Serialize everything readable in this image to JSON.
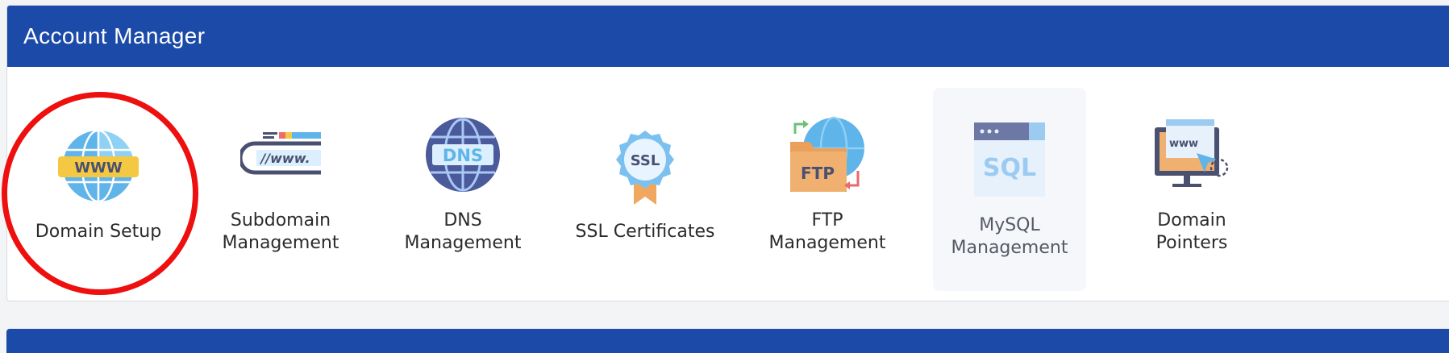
{
  "panel": {
    "title": "Account Manager",
    "items": [
      {
        "label": "Domain Setup",
        "icon": "www-globe-icon"
      },
      {
        "label": "Subdomain\nManagement",
        "icon": "subdomain-bar-icon"
      },
      {
        "label": "DNS\nManagement",
        "icon": "dns-globe-icon"
      },
      {
        "label": "SSL Certificates",
        "icon": "ssl-badge-icon"
      },
      {
        "label": "FTP\nManagement",
        "icon": "ftp-folder-icon"
      },
      {
        "label": "MySQL\nManagement",
        "icon": "sql-window-icon"
      },
      {
        "label": "Domain\nPointers",
        "icon": "pointer-monitor-icon"
      }
    ]
  },
  "icon_text": {
    "www": "WWW",
    "subdomain": "//www.",
    "dns": "DNS",
    "ssl": "SSL",
    "ftp": "FTP",
    "sql": "SQL",
    "pointer": "www"
  },
  "colors": {
    "header": "#1c4aa8",
    "highlight": "#ee0f0f"
  }
}
